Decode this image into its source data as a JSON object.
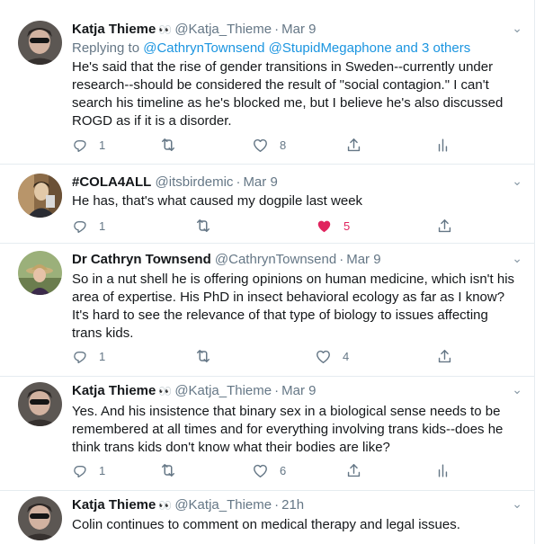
{
  "colors": {
    "link": "#1b95e0",
    "muted": "#657786",
    "text": "#14171a",
    "like_active": "#e0245e",
    "divider": "#e6ecf0"
  },
  "icons": {
    "reply": "reply-icon",
    "retweet": "retweet-icon",
    "like": "heart-icon",
    "like_active": "heart-filled-icon",
    "share": "share-icon",
    "analytics": "analytics-icon",
    "menu": "chevron-down-icon"
  },
  "tweets": [
    {
      "name": "Katja Thieme",
      "emoji": "👀",
      "handle": "@Katja_Thieme",
      "separator": "·",
      "time": "Mar 9",
      "reply_prefix": "Replying to",
      "reply_to": "@CathrynTownsend @StupidMegaphone and 3 others",
      "text": "He's said that the rise of gender transitions in Sweden--currently under research--should be considered the result of \"social contagion.\" I can't search his timeline as he's blocked me, but I believe he's also discussed ROGD as if it is a disorder.",
      "replies": "1",
      "retweets": "",
      "likes": "8",
      "liked": false
    },
    {
      "name": "#COLA4ALL",
      "handle": "@itsbirdemic",
      "separator": "·",
      "time": "Mar 9",
      "text": "He has, that's what caused my dogpile last week",
      "replies": "1",
      "retweets": "",
      "likes": "5",
      "liked": true
    },
    {
      "name": "Dr Cathryn Townsend",
      "handle": "@CathrynTownsend",
      "separator": "·",
      "time": "Mar 9",
      "text": "So in a nut shell he is offering opinions on human medicine, which isn't his area of expertise. His PhD in insect behavioral ecology as far as I know? It's hard to see the relevance of that type of biology to issues affecting trans kids.",
      "replies": "1",
      "retweets": "",
      "likes": "4",
      "liked": false
    },
    {
      "name": "Katja Thieme",
      "emoji": "👀",
      "handle": "@Katja_Thieme",
      "separator": "·",
      "time": "Mar 9",
      "text": "Yes. And his insistence that binary sex in a biological sense needs to be remembered at all times and for everything involving trans kids--does he think trans kids don't know what their bodies are like?",
      "replies": "1",
      "retweets": "",
      "likes": "6",
      "liked": false
    },
    {
      "name": "Katja Thieme",
      "emoji": "👀",
      "handle": "@Katja_Thieme",
      "separator": "·",
      "time": "21h",
      "text": "Colin continues to comment on medical therapy and legal issues."
    }
  ]
}
